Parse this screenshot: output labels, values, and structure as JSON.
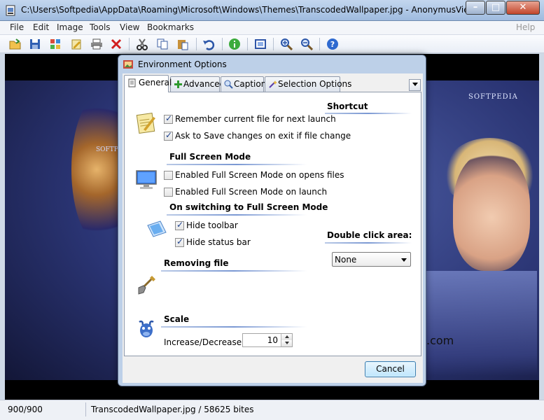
{
  "window": {
    "title": "C:\\Users\\Softpedia\\AppData\\Roaming\\Microsoft\\Windows\\Themes\\TranscodedWallpaper.jpg - AnonymusViewer",
    "minimize_glyph": "–",
    "maximize_glyph": "□",
    "close_glyph": "✕"
  },
  "menu": {
    "items": [
      "File",
      "Edit",
      "Image",
      "Tools",
      "View",
      "Bookmarks"
    ],
    "help": "Help"
  },
  "toolbar": {
    "icons": [
      "open-folder-icon",
      "save-icon",
      "thumbnails-icon",
      "edit-icon",
      "print-icon",
      "delete-icon",
      "cut-icon",
      "copy-icon",
      "paste-icon",
      "undo-icon",
      "info-icon",
      "fullscreen-icon",
      "zoom-in-icon",
      "zoom-out-icon",
      "help-icon"
    ]
  },
  "image": {
    "watermark_left": "SOFTP",
    "watermark_right": "SOFTPEDIA",
    "watermark_com": ".com"
  },
  "status": {
    "left": "900/900",
    "right": "TranscodedWallpaper.jpg / 58625 bites"
  },
  "dialog": {
    "title": "Environment Options",
    "tabs": [
      {
        "label": "General",
        "icon": "page-icon"
      },
      {
        "label": "Advanced",
        "icon": "plus-icon"
      },
      {
        "label": "Caption",
        "icon": "caption-icon"
      },
      {
        "label": "Selection Options",
        "icon": "wand-icon"
      }
    ],
    "general": {
      "remember_file": {
        "label": "Remember current file for next launch",
        "checked": true
      },
      "ask_save": {
        "label": "Ask to Save changes on exit if file change",
        "checked": true
      },
      "full_screen_heading": "Full Screen Mode",
      "fs_open_files": {
        "label": "Enabled Full Screen Mode on opens files",
        "checked": false
      },
      "fs_launch": {
        "label": "Enabled Full Screen Mode on launch",
        "checked": false
      },
      "switching_heading": "On switching to Full Screen Mode",
      "hide_toolbar": {
        "label": "Hide toolbar",
        "checked": true
      },
      "hide_status": {
        "label": "Hide status bar",
        "checked": true
      },
      "removing_heading": "Removing file",
      "scale_heading": "Scale",
      "scale_label": "Increase/Decrease on",
      "scale_value": "10",
      "shortcut_heading": "Shortcut",
      "double_click_heading": "Double click area:",
      "double_click_value": "None"
    },
    "cancel_label": "Cancel"
  }
}
